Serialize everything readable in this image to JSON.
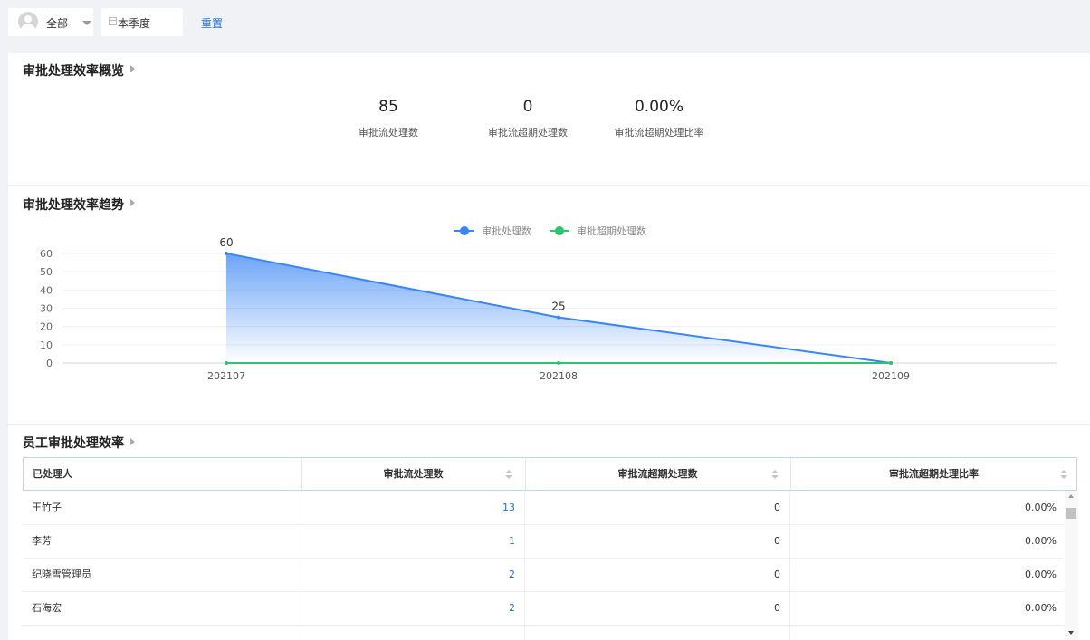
{
  "filters": {
    "user_label": "全部",
    "date_label": "本季度",
    "reset_label": "重置"
  },
  "overview": {
    "title": "审批处理效率概览",
    "stats": [
      {
        "value": "85",
        "label": "审批流处理数"
      },
      {
        "value": "0",
        "label": "审批流超期处理数"
      },
      {
        "value": "0.00%",
        "label": "审批流超期处理比率"
      }
    ]
  },
  "trend": {
    "title": "审批处理效率趋势"
  },
  "chart_data": {
    "type": "line",
    "categories": [
      "202107",
      "202108",
      "202109"
    ],
    "series": [
      {
        "name": "审批处理数",
        "values": [
          60,
          25,
          0
        ],
        "color": "#3b86f5",
        "area": true,
        "labels": [
          "60",
          "25",
          ""
        ]
      },
      {
        "name": "审批超期处理数",
        "values": [
          0,
          0,
          0
        ],
        "color": "#2ec46f",
        "area": false,
        "labels": [
          "",
          "",
          ""
        ]
      }
    ],
    "yticks": [
      0,
      10,
      20,
      30,
      40,
      50,
      60
    ],
    "ylim": [
      0,
      60
    ],
    "legend": "top-center",
    "grid": true
  },
  "employee": {
    "title": "员工审批处理效率",
    "columns": [
      "已处理人",
      "审批流处理数",
      "审批流超期处理数",
      "审批流超期处理比率"
    ],
    "rows": [
      {
        "name": "王竹子",
        "count": "13",
        "overdue": "0",
        "rate": "0.00%"
      },
      {
        "name": "李芳",
        "count": "1",
        "overdue": "0",
        "rate": "0.00%"
      },
      {
        "name": "纪晓雪管理员",
        "count": "2",
        "overdue": "0",
        "rate": "0.00%"
      },
      {
        "name": "石海宏",
        "count": "2",
        "overdue": "0",
        "rate": "0.00%"
      }
    ]
  },
  "colors": {
    "accent": "#1e6fd9",
    "series_primary": "#3b86f5",
    "series_secondary": "#2ec46f"
  }
}
